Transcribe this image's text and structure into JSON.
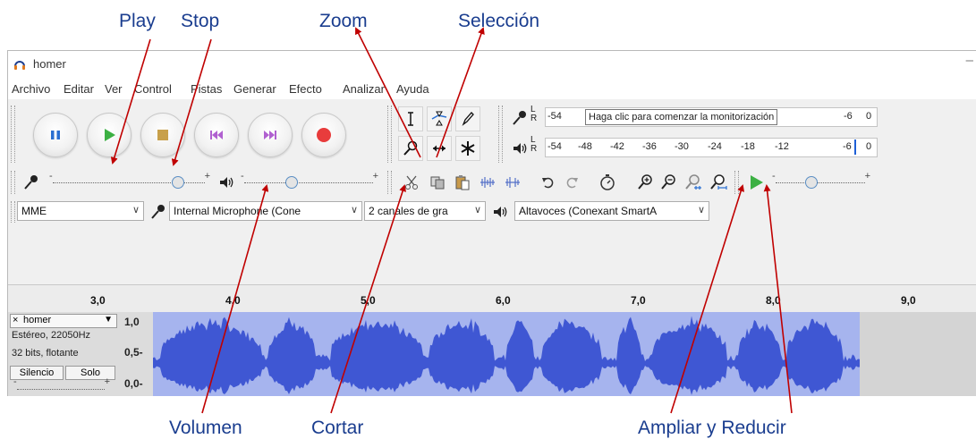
{
  "annotations": {
    "play": "Play",
    "stop": "Stop",
    "zoom": "Zoom",
    "seleccion": "Selección",
    "volumen": "Volumen",
    "cortar": "Cortar",
    "ampliar_reducir": "Ampliar y Reducir"
  },
  "window": {
    "title": "homer",
    "minimize_symbol": "–",
    "icon": "headphones-icon"
  },
  "menu": [
    "Archivo",
    "Editar",
    "Ver",
    "Control",
    "Pistas",
    "Generar",
    "Efecto",
    "Analizar",
    "Ayuda"
  ],
  "transport": {
    "buttons": [
      "pause",
      "play",
      "stop",
      "skip-to-start",
      "skip-to-end",
      "record"
    ],
    "colors": {
      "pause": "#2a6fd1",
      "play": "#3cb043",
      "stop": "#c8a04a",
      "skip": "#b060d0",
      "record": "#e83c3c"
    }
  },
  "tools": [
    "selection-tool",
    "envelope-tool",
    "draw-tool",
    "zoom-tool",
    "timeshift-tool",
    "multi-tool"
  ],
  "meters": {
    "record_channels": "L\nR",
    "record_tooltip": "Haga clic para comenzar la monitorización",
    "record_scale": [
      "-54",
      "-6",
      "0"
    ],
    "play_scale": [
      "-54",
      "-48",
      "-42",
      "-36",
      "-30",
      "-24",
      "-18",
      "-12",
      "-6",
      "0"
    ]
  },
  "mixer": {
    "minus": "-",
    "plus": "+",
    "record_volume_level": 0.84,
    "play_volume_level": 0.35,
    "speed_level": 0.38
  },
  "edit_tools": [
    "cut-icon",
    "copy-icon",
    "paste-icon",
    "trim-icon",
    "silence-icon",
    "undo-icon",
    "redo-icon",
    "sync-lock-icon",
    "zoom-in-icon",
    "zoom-out-icon",
    "fit-selection-icon",
    "fit-project-icon",
    "play-at-speed-icon"
  ],
  "device": {
    "host": "MME",
    "input": "Internal Microphone (Cone",
    "channels": "2 canales de gra",
    "output": "Altavoces (Conexant SmartA"
  },
  "ruler": {
    "ticks": [
      "3,0",
      "4,0",
      "5,0",
      "6,0",
      "7,0",
      "8,0",
      "9,0"
    ]
  },
  "track": {
    "close": "×",
    "name": "homer",
    "menu_arrow": "▼",
    "format": "Estéreo, 22050Hz",
    "bits": "32 bits, flotante",
    "mute": "Silencio",
    "solo": "Solo",
    "gain_minus": "-",
    "gain_plus": "+",
    "scale": [
      "1,0",
      "0,5-",
      "0,0-"
    ]
  },
  "colors": {
    "annotation_text": "#1a3d8f",
    "arrow": "#c00000",
    "waveform": "#3f57d3",
    "waveform_bg": "#a6b4ee",
    "meter_marker": "#1e5fd6"
  }
}
